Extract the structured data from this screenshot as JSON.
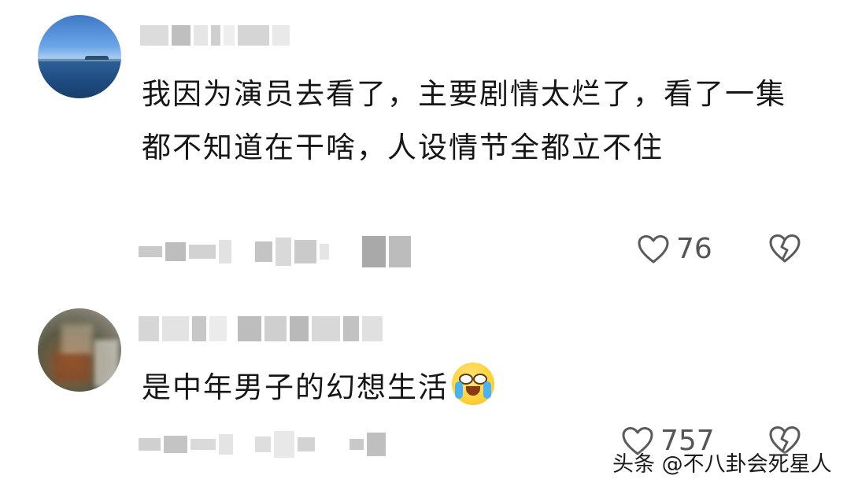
{
  "comments": [
    {
      "text": "我因为演员去看了，主要剧情太烂了，看了一集都不知道在干啥，人设情节全都立不住",
      "likes": "76"
    },
    {
      "text": "是中年男子的幻想生活",
      "likes": "757"
    }
  ],
  "watermark": "头条 @不八卦会死星人",
  "icons": {
    "like": "heart-outline-icon",
    "dislike": "broken-heart-icon",
    "emoji": "crying-laughing-emoji-icon"
  }
}
